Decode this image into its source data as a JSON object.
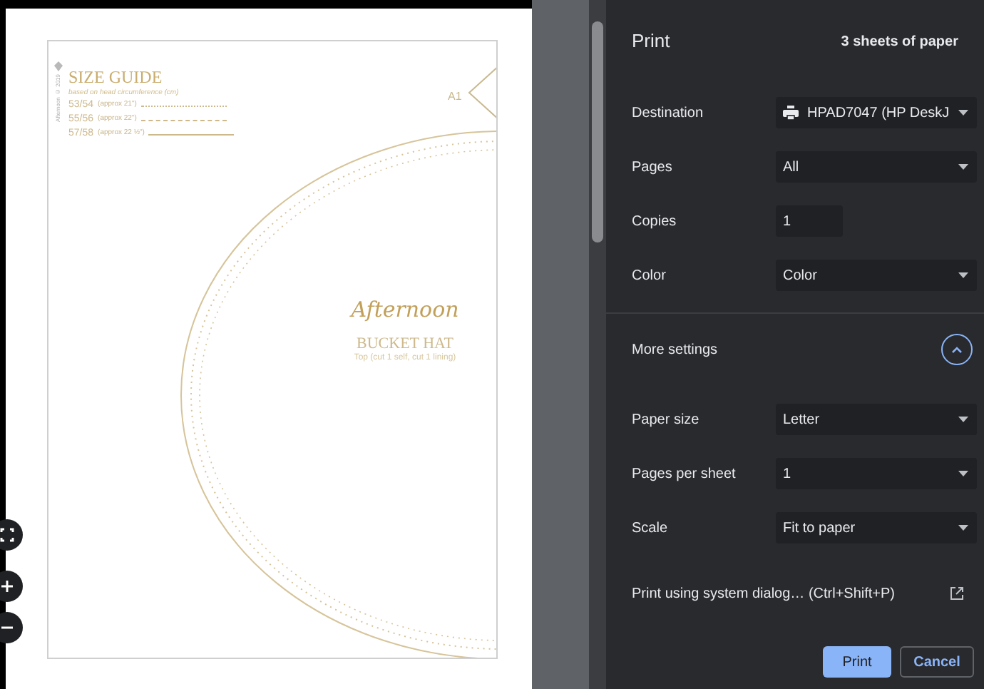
{
  "preview": {
    "page": {
      "watermark": "Afternoon © 2019",
      "title": "SIZE GUIDE",
      "subtitle": "based on head circumference (cm)",
      "sizes": [
        {
          "size": "53/54",
          "approx": "(approx 21\")"
        },
        {
          "size": "55/56",
          "approx": "(approx 22\")"
        },
        {
          "size": "57/58",
          "approx": "(approx 22 ½\")"
        }
      ],
      "piece_label": "A1",
      "brand": "Afternoon",
      "pattern_name": "BUCKET HAT",
      "pattern_note": "Top (cut 1 self, cut 1 lining)"
    }
  },
  "print": {
    "title": "Print",
    "sheets": "3 sheets of paper",
    "settings": [
      {
        "label": "Destination",
        "kind": "destination",
        "value": "HPAD7047 (HP DeskJ"
      },
      {
        "label": "Pages",
        "kind": "select",
        "value": "All"
      },
      {
        "label": "Copies",
        "kind": "input",
        "value": "1"
      },
      {
        "label": "Color",
        "kind": "select",
        "value": "Color"
      }
    ],
    "more_settings": {
      "label": "More settings",
      "expanded": true
    },
    "more": [
      {
        "label": "Paper size",
        "kind": "select",
        "value": "Letter"
      },
      {
        "label": "Pages per sheet",
        "kind": "select",
        "value": "1"
      },
      {
        "label": "Scale",
        "kind": "select",
        "value": "Fit to paper"
      }
    ],
    "system_dialog": "Print using system dialog… (Ctrl+Shift+P)",
    "buttons": [
      {
        "label": "Print",
        "kind": "primary"
      },
      {
        "label": "Cancel",
        "kind": "secondary"
      }
    ]
  }
}
